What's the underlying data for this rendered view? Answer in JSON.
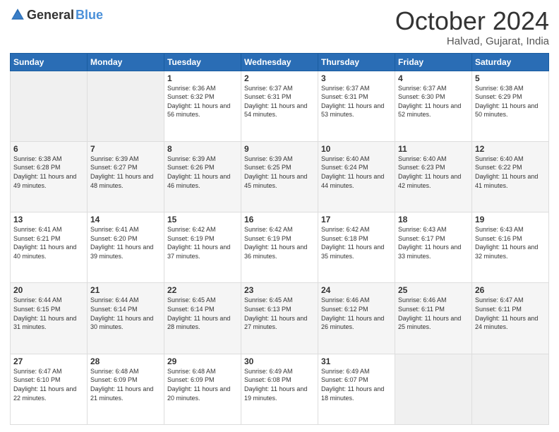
{
  "header": {
    "logo_general": "General",
    "logo_blue": "Blue",
    "month_title": "October 2024",
    "location": "Halvad, Gujarat, India"
  },
  "weekdays": [
    "Sunday",
    "Monday",
    "Tuesday",
    "Wednesday",
    "Thursday",
    "Friday",
    "Saturday"
  ],
  "weeks": [
    [
      {
        "day": "",
        "sunrise": "",
        "sunset": "",
        "daylight": "",
        "empty": true
      },
      {
        "day": "",
        "sunrise": "",
        "sunset": "",
        "daylight": "",
        "empty": true
      },
      {
        "day": "1",
        "sunrise": "Sunrise: 6:36 AM",
        "sunset": "Sunset: 6:32 PM",
        "daylight": "Daylight: 11 hours and 56 minutes."
      },
      {
        "day": "2",
        "sunrise": "Sunrise: 6:37 AM",
        "sunset": "Sunset: 6:31 PM",
        "daylight": "Daylight: 11 hours and 54 minutes."
      },
      {
        "day": "3",
        "sunrise": "Sunrise: 6:37 AM",
        "sunset": "Sunset: 6:31 PM",
        "daylight": "Daylight: 11 hours and 53 minutes."
      },
      {
        "day": "4",
        "sunrise": "Sunrise: 6:37 AM",
        "sunset": "Sunset: 6:30 PM",
        "daylight": "Daylight: 11 hours and 52 minutes."
      },
      {
        "day": "5",
        "sunrise": "Sunrise: 6:38 AM",
        "sunset": "Sunset: 6:29 PM",
        "daylight": "Daylight: 11 hours and 50 minutes."
      }
    ],
    [
      {
        "day": "6",
        "sunrise": "Sunrise: 6:38 AM",
        "sunset": "Sunset: 6:28 PM",
        "daylight": "Daylight: 11 hours and 49 minutes."
      },
      {
        "day": "7",
        "sunrise": "Sunrise: 6:39 AM",
        "sunset": "Sunset: 6:27 PM",
        "daylight": "Daylight: 11 hours and 48 minutes."
      },
      {
        "day": "8",
        "sunrise": "Sunrise: 6:39 AM",
        "sunset": "Sunset: 6:26 PM",
        "daylight": "Daylight: 11 hours and 46 minutes."
      },
      {
        "day": "9",
        "sunrise": "Sunrise: 6:39 AM",
        "sunset": "Sunset: 6:25 PM",
        "daylight": "Daylight: 11 hours and 45 minutes."
      },
      {
        "day": "10",
        "sunrise": "Sunrise: 6:40 AM",
        "sunset": "Sunset: 6:24 PM",
        "daylight": "Daylight: 11 hours and 44 minutes."
      },
      {
        "day": "11",
        "sunrise": "Sunrise: 6:40 AM",
        "sunset": "Sunset: 6:23 PM",
        "daylight": "Daylight: 11 hours and 42 minutes."
      },
      {
        "day": "12",
        "sunrise": "Sunrise: 6:40 AM",
        "sunset": "Sunset: 6:22 PM",
        "daylight": "Daylight: 11 hours and 41 minutes."
      }
    ],
    [
      {
        "day": "13",
        "sunrise": "Sunrise: 6:41 AM",
        "sunset": "Sunset: 6:21 PM",
        "daylight": "Daylight: 11 hours and 40 minutes."
      },
      {
        "day": "14",
        "sunrise": "Sunrise: 6:41 AM",
        "sunset": "Sunset: 6:20 PM",
        "daylight": "Daylight: 11 hours and 39 minutes."
      },
      {
        "day": "15",
        "sunrise": "Sunrise: 6:42 AM",
        "sunset": "Sunset: 6:19 PM",
        "daylight": "Daylight: 11 hours and 37 minutes."
      },
      {
        "day": "16",
        "sunrise": "Sunrise: 6:42 AM",
        "sunset": "Sunset: 6:19 PM",
        "daylight": "Daylight: 11 hours and 36 minutes."
      },
      {
        "day": "17",
        "sunrise": "Sunrise: 6:42 AM",
        "sunset": "Sunset: 6:18 PM",
        "daylight": "Daylight: 11 hours and 35 minutes."
      },
      {
        "day": "18",
        "sunrise": "Sunrise: 6:43 AM",
        "sunset": "Sunset: 6:17 PM",
        "daylight": "Daylight: 11 hours and 33 minutes."
      },
      {
        "day": "19",
        "sunrise": "Sunrise: 6:43 AM",
        "sunset": "Sunset: 6:16 PM",
        "daylight": "Daylight: 11 hours and 32 minutes."
      }
    ],
    [
      {
        "day": "20",
        "sunrise": "Sunrise: 6:44 AM",
        "sunset": "Sunset: 6:15 PM",
        "daylight": "Daylight: 11 hours and 31 minutes."
      },
      {
        "day": "21",
        "sunrise": "Sunrise: 6:44 AM",
        "sunset": "Sunset: 6:14 PM",
        "daylight": "Daylight: 11 hours and 30 minutes."
      },
      {
        "day": "22",
        "sunrise": "Sunrise: 6:45 AM",
        "sunset": "Sunset: 6:14 PM",
        "daylight": "Daylight: 11 hours and 28 minutes."
      },
      {
        "day": "23",
        "sunrise": "Sunrise: 6:45 AM",
        "sunset": "Sunset: 6:13 PM",
        "daylight": "Daylight: 11 hours and 27 minutes."
      },
      {
        "day": "24",
        "sunrise": "Sunrise: 6:46 AM",
        "sunset": "Sunset: 6:12 PM",
        "daylight": "Daylight: 11 hours and 26 minutes."
      },
      {
        "day": "25",
        "sunrise": "Sunrise: 6:46 AM",
        "sunset": "Sunset: 6:11 PM",
        "daylight": "Daylight: 11 hours and 25 minutes."
      },
      {
        "day": "26",
        "sunrise": "Sunrise: 6:47 AM",
        "sunset": "Sunset: 6:11 PM",
        "daylight": "Daylight: 11 hours and 24 minutes."
      }
    ],
    [
      {
        "day": "27",
        "sunrise": "Sunrise: 6:47 AM",
        "sunset": "Sunset: 6:10 PM",
        "daylight": "Daylight: 11 hours and 22 minutes."
      },
      {
        "day": "28",
        "sunrise": "Sunrise: 6:48 AM",
        "sunset": "Sunset: 6:09 PM",
        "daylight": "Daylight: 11 hours and 21 minutes."
      },
      {
        "day": "29",
        "sunrise": "Sunrise: 6:48 AM",
        "sunset": "Sunset: 6:09 PM",
        "daylight": "Daylight: 11 hours and 20 minutes."
      },
      {
        "day": "30",
        "sunrise": "Sunrise: 6:49 AM",
        "sunset": "Sunset: 6:08 PM",
        "daylight": "Daylight: 11 hours and 19 minutes."
      },
      {
        "day": "31",
        "sunrise": "Sunrise: 6:49 AM",
        "sunset": "Sunset: 6:07 PM",
        "daylight": "Daylight: 11 hours and 18 minutes."
      },
      {
        "day": "",
        "sunrise": "",
        "sunset": "",
        "daylight": "",
        "empty": true
      },
      {
        "day": "",
        "sunrise": "",
        "sunset": "",
        "daylight": "",
        "empty": true
      }
    ]
  ]
}
